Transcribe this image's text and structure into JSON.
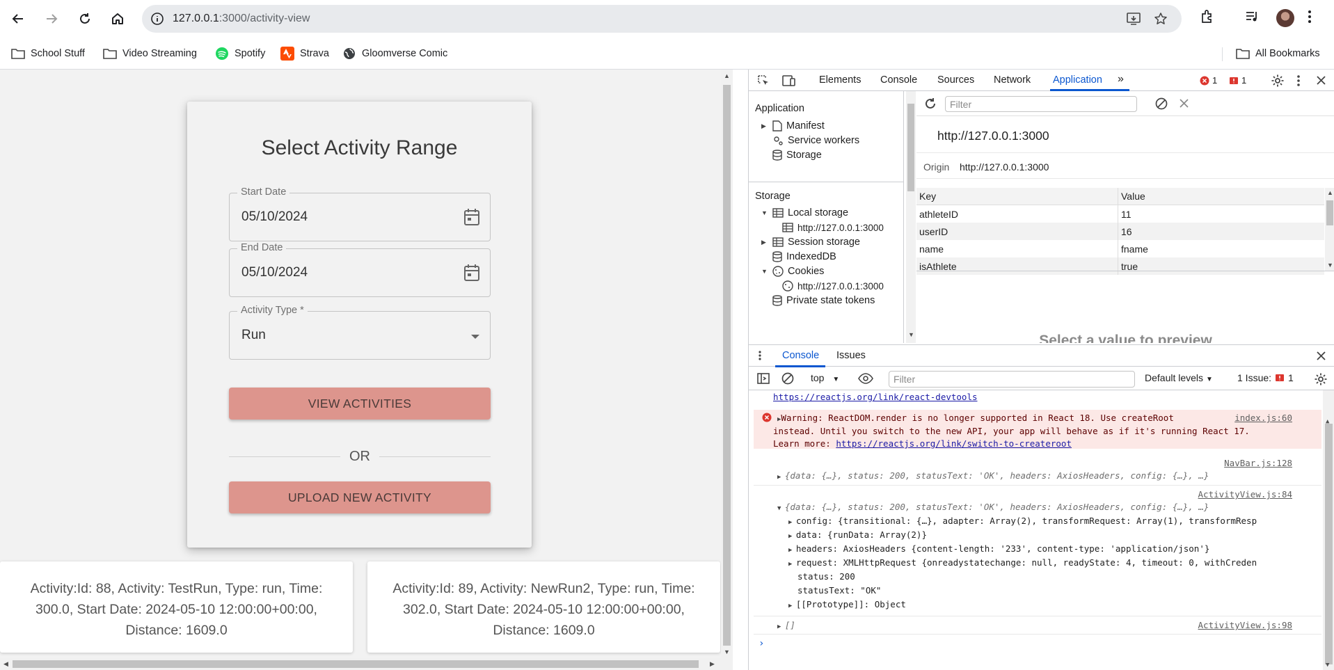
{
  "browser": {
    "url_host": "127.0.0.1",
    "url_path": ":3000/activity-view",
    "bookmarks": [
      "School Stuff",
      "Video Streaming",
      "Spotify",
      "Strava",
      "Gloomverse Comic"
    ],
    "all_bookmarks": "All Bookmarks"
  },
  "form": {
    "title": "Select Activity Range",
    "start_label": "Start Date",
    "start_value": "05/10/2024",
    "end_label": "End Date",
    "end_value": "05/10/2024",
    "type_label": "Activity Type *",
    "type_value": "Run",
    "view_button": "VIEW ACTIVITIES",
    "or_text": "OR",
    "upload_button": "UPLOAD NEW ACTIVITY"
  },
  "activities": [
    {
      "line1": "Activity:Id: 88, Activity: TestRun, Type: run, Time:",
      "line2": "300.0, Start Date: 2024-05-10 12:00:00+00:00,",
      "line3": "Distance: 1609.0"
    },
    {
      "line1": "Activity:Id: 89, Activity: NewRun2, Type: run, Time:",
      "line2": "302.0, Start Date: 2024-05-10 12:00:00+00:00,",
      "line3": "Distance: 1609.0"
    }
  ],
  "devtools": {
    "tabs": [
      "Elements",
      "Console",
      "Sources",
      "Network",
      "Application"
    ],
    "error_count": "1",
    "issue_count": "1",
    "sidebar": {
      "application_header": "Application",
      "manifest": "Manifest",
      "service_workers": "Service workers",
      "storage": "Storage",
      "storage_header": "Storage",
      "local_storage": "Local storage",
      "local_origin": "http://127.0.0.1:3000",
      "session_storage": "Session storage",
      "indexeddb": "IndexedDB",
      "cookies": "Cookies",
      "cookie_origin": "http://127.0.0.1:3000",
      "private_state": "Private state tokens"
    },
    "filter_placeholder": "Filter",
    "origin_header": "http://127.0.0.1:3000",
    "origin_label": "Origin",
    "origin_value": "http://127.0.0.1:3000",
    "table_headers": [
      "Key",
      "Value"
    ],
    "rows": [
      {
        "key": "athleteID",
        "value": "11"
      },
      {
        "key": "userID",
        "value": "16"
      },
      {
        "key": "name",
        "value": "fname"
      },
      {
        "key": "isAthlete",
        "value": "true"
      }
    ],
    "preview_text": "Select a value to preview",
    "drawer_tabs": [
      "Console",
      "Issues"
    ],
    "context": "top",
    "console_filter_placeholder": "Filter",
    "levels": "Default levels",
    "issues_label": "1 Issue:",
    "issues_count": "1",
    "console": {
      "link_top": "https://reactjs.org/link/react-devtools",
      "warn1": "Warning: ReactDOM.render is no longer supported in React 18. Use createRoot",
      "warn_src": "index.js:60",
      "warn2": "instead. Until you switch to the new API, your app will behave as if it's running React 17.",
      "warn3_prefix": "Learn more: ",
      "warn3_link": "https://reactjs.org/link/switch-to-createroot",
      "src_navbar": "NavBar.js:128",
      "obj1": "{data: {…}, status: 200, statusText: 'OK', headers: AxiosHeaders, config: {…}, …}",
      "src_av84": "ActivityView.js:84",
      "obj2": "{data: {…}, status: 200, statusText: 'OK', headers: AxiosHeaders, config: {…}, …}",
      "config_line": "config: {transitional: {…}, adapter: Array(2), transformRequest: Array(1), transformResp",
      "data_line": "data: {runData: Array(2)}",
      "headers_line": "headers: AxiosHeaders {content-length: '233', content-type: 'application/json'}",
      "request_line": "request: XMLHttpRequest {onreadystatechange: null, readyState: 4, timeout: 0, withCreden",
      "status_line": "status: 200",
      "statustext_line": "statusText: \"OK\"",
      "proto_line": "[[Prototype]]: Object",
      "empty_array": "[]",
      "src_av98": "ActivityView.js:98"
    }
  }
}
